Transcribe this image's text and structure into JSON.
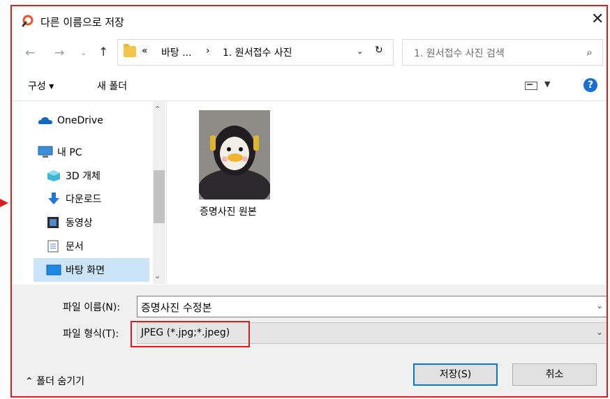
{
  "window": {
    "title": "다른 이름으로 저장"
  },
  "nav": {
    "address_parts": [
      "«",
      "바탕 ...",
      "›",
      "1. 원서접수 사진"
    ],
    "search_placeholder": "1. 원서접수 사진 검색"
  },
  "toolbar": {
    "organize_label": "구성 ▾",
    "new_folder_label": "새 폴더"
  },
  "sidebar": {
    "items": [
      {
        "label": "OneDrive",
        "icon": "onedrive-icon"
      },
      {
        "label": "내 PC",
        "icon": "pc-icon"
      },
      {
        "label": "3D 개체",
        "icon": "3d-objects-icon"
      },
      {
        "label": "다운로드",
        "icon": "download-icon"
      },
      {
        "label": "동영상",
        "icon": "video-icon"
      },
      {
        "label": "문서",
        "icon": "document-icon"
      },
      {
        "label": "바탕 화면",
        "icon": "desktop-icon",
        "selected": true
      }
    ]
  },
  "files": [
    {
      "name": "증명사진 원본",
      "icon": "photo-thumbnail"
    }
  ],
  "form": {
    "filename_label": "파일 이름(N):",
    "filename_value": "증명사진 수정본",
    "filetype_label": "파일 형식(T):",
    "filetype_value": "JPEG (*.jpg;*.jpeg)"
  },
  "buttons": {
    "save_label": "저장(S)",
    "cancel_label": "취소"
  },
  "footer": {
    "hide_folders_label": "폴더 숨기기"
  },
  "colors": {
    "accent": "#0078d7",
    "highlight_red": "#d81e1e",
    "selection": "#cce4f7"
  }
}
